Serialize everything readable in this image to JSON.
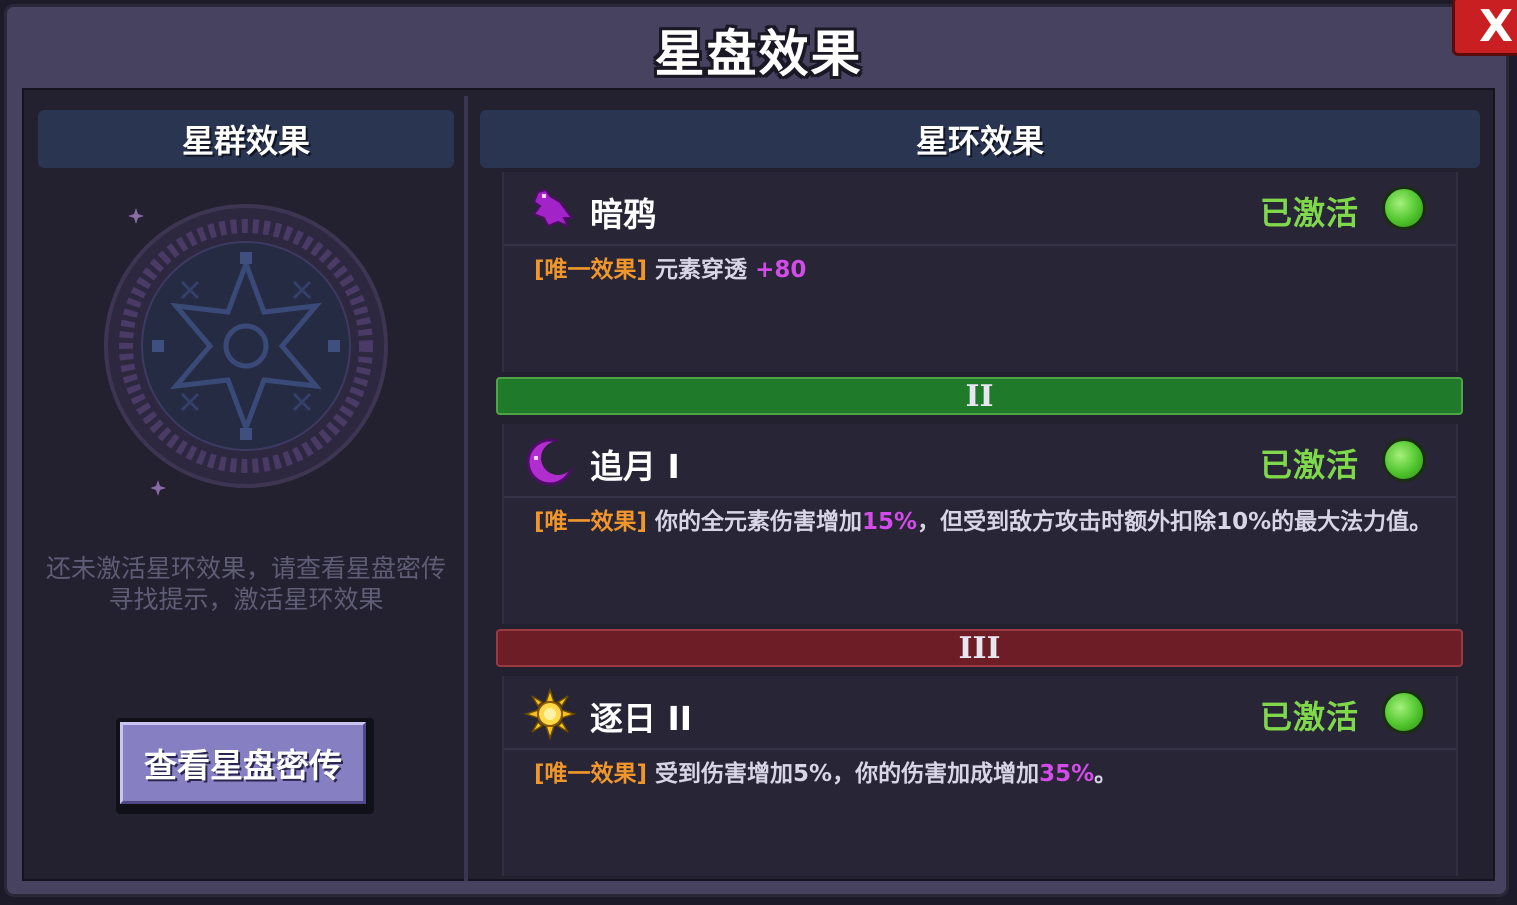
{
  "window": {
    "title": "星盘效果",
    "close_label": "X"
  },
  "left_panel": {
    "tab_label": "星群效果",
    "hint": "还未激活星环效果，请查看星盘密传寻找提示，激活星环效果",
    "view_button_label": "查看星盘密传"
  },
  "right_panel": {
    "tab_label": "星环效果",
    "rings": [
      {
        "name": "暗鸦",
        "icon": "crow-icon",
        "status": "已激活",
        "tag": "[唯一效果]",
        "desc_pre": "元素穿透 ",
        "desc_hl": "+80",
        "desc_post": ""
      },
      {
        "name": "追月 I",
        "icon": "crescent-moon-icon",
        "status": "已激活",
        "tag": "[唯一效果]",
        "desc_pre": "你的全元素伤害增加",
        "desc_hl": "15%",
        "desc_post": "，但受到敌方攻击时额外扣除10%的最大法力值。"
      },
      {
        "name": "逐日 II",
        "icon": "sun-icon",
        "status": "已激活",
        "tag": "[唯一效果]",
        "desc_pre": "受到伤害增加5%，你的伤害加成增加",
        "desc_hl": "35%",
        "desc_post": "。"
      }
    ],
    "tiers": [
      "II",
      "III"
    ]
  },
  "colors": {
    "active_green": "#7fd84b",
    "tag_orange": "#f0962a",
    "highlight_pink": "#d34be8",
    "tier2_bar": "#1f7a2a",
    "tier3_bar": "#6c1d25"
  }
}
